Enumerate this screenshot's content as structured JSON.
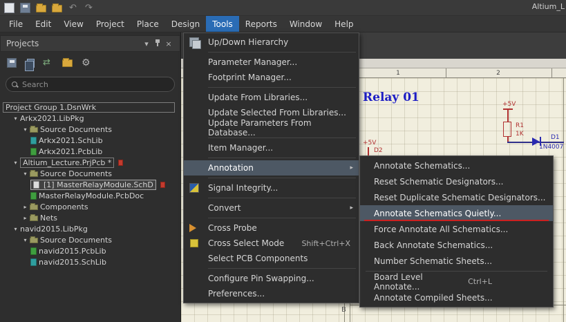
{
  "window": {
    "title": "Altium_L"
  },
  "menubar": {
    "items": [
      {
        "label": "File"
      },
      {
        "label": "Edit"
      },
      {
        "label": "View"
      },
      {
        "label": "Project"
      },
      {
        "label": "Place"
      },
      {
        "label": "Design"
      },
      {
        "label": "Tools"
      },
      {
        "label": "Reports"
      },
      {
        "label": "Window"
      },
      {
        "label": "Help"
      }
    ]
  },
  "projects_panel": {
    "title": "Projects",
    "search": {
      "placeholder": "Search"
    },
    "tree": [
      {
        "label": "Project Group 1.DsnWrk"
      },
      {
        "label": "Arkx2021.LibPkg"
      },
      {
        "label": "Source Documents"
      },
      {
        "label": "Arkx2021.SchLib"
      },
      {
        "label": "Arkx2021.PcbLib"
      },
      {
        "label": "Altium_Lecture.PrjPcb *"
      },
      {
        "label": "Source Documents"
      },
      {
        "label": "[1] MasterRelayModule.SchD"
      },
      {
        "label": "MasterRelayModule.PcbDoc"
      },
      {
        "label": "Components"
      },
      {
        "label": "Nets"
      },
      {
        "label": "navid2015.LibPkg"
      },
      {
        "label": "Source Documents"
      },
      {
        "label": "navid2015.PcbLib"
      },
      {
        "label": "navid2015.SchLib"
      }
    ]
  },
  "tools_menu": {
    "items": [
      {
        "label": "Up/Down Hierarchy"
      },
      {
        "label": "Parameter Manager..."
      },
      {
        "label": "Footprint Manager..."
      },
      {
        "label": "Update From Libraries..."
      },
      {
        "label": "Update Selected From Libraries..."
      },
      {
        "label": "Update Parameters From Database..."
      },
      {
        "label": "Item Manager..."
      },
      {
        "label": "Annotation"
      },
      {
        "label": "Signal Integrity..."
      },
      {
        "label": "Convert"
      },
      {
        "label": "Cross Probe"
      },
      {
        "label": "Cross Select Mode",
        "shortcut": "Shift+Ctrl+X"
      },
      {
        "label": "Select PCB Components"
      },
      {
        "label": "Configure Pin Swapping..."
      },
      {
        "label": "Preferences..."
      }
    ]
  },
  "annotation_submenu": {
    "items": [
      {
        "label": "Annotate Schematics..."
      },
      {
        "label": "Reset Schematic Designators..."
      },
      {
        "label": "Reset Duplicate Schematic Designators..."
      },
      {
        "label": "Annotate Schematics Quietly..."
      },
      {
        "label": "Force Annotate All Schematics..."
      },
      {
        "label": "Back Annotate Schematics..."
      },
      {
        "label": "Number Schematic Sheets..."
      },
      {
        "label": "Board Level Annotate...",
        "shortcut": "Ctrl+L"
      },
      {
        "label": "Annotate Compiled Sheets..."
      }
    ]
  },
  "schematic": {
    "title": "Relay 01",
    "ruler": {
      "labels": [
        "1",
        "2"
      ]
    },
    "zone_label": "B",
    "labels": {
      "pwr1": "+5V",
      "r_des": "R1",
      "r_val": "1K",
      "d1_des": "D1",
      "d1_val": "1N4007",
      "pwr2": "+5V",
      "d2_des": "D2"
    }
  },
  "colors": {
    "accent_blue": "#2a6cb5",
    "menu_highlight": "#4d5864",
    "annotation_red": "#cc2020",
    "sheet_cream": "#f1eede"
  }
}
